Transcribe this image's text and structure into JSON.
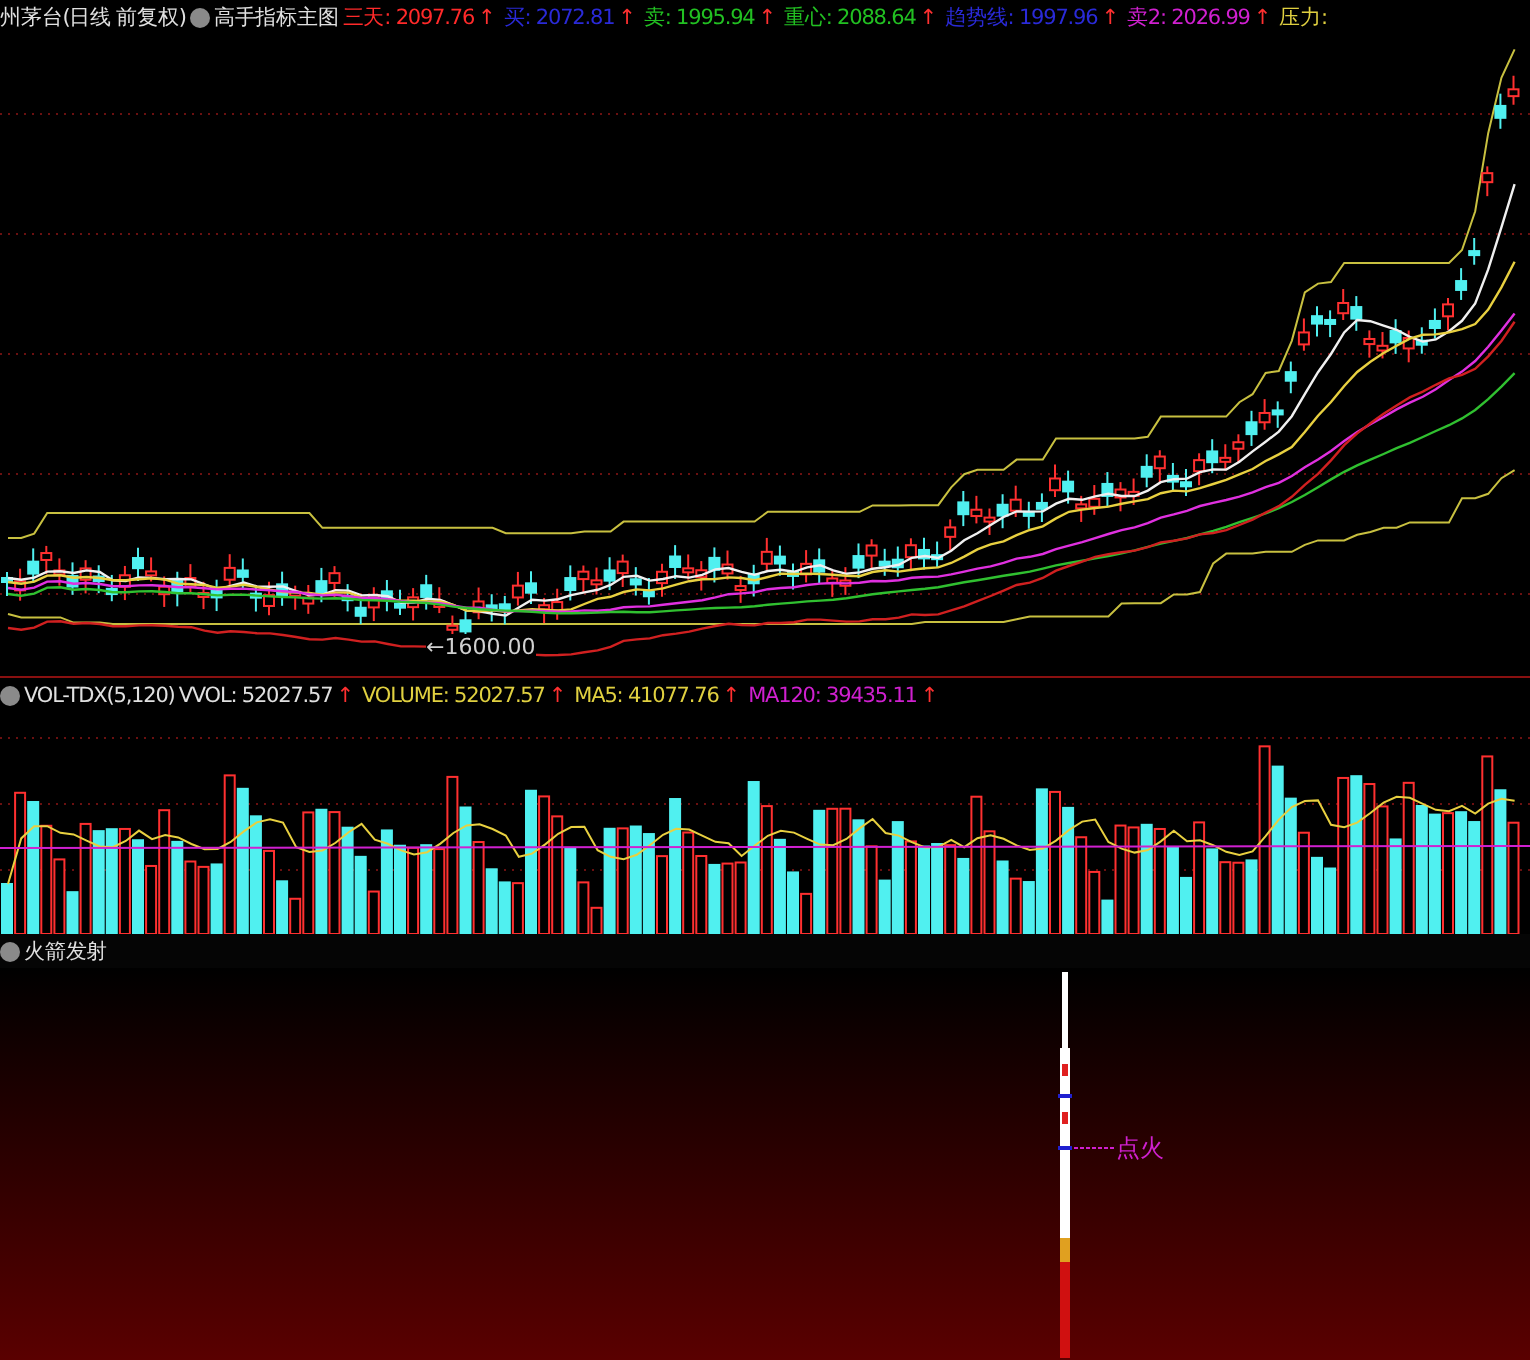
{
  "main_header": {
    "stock_title": "州茅台(日线 前复权)",
    "indicator_name": "高手指标主图",
    "values": [
      {
        "label": "三天:",
        "value": "2097.76",
        "arrow": "↑",
        "color": "#ff2a2a"
      },
      {
        "label": "买:",
        "value": "2072.81",
        "arrow": "↑",
        "color": "#2a2ad8"
      },
      {
        "label": "卖:",
        "value": "1995.94",
        "arrow": "↑",
        "color": "#22c022"
      },
      {
        "label": "重心:",
        "value": "2088.64",
        "arrow": "↑",
        "color": "#22c022"
      },
      {
        "label": "趋势线:",
        "value": "1997.96",
        "arrow": "↑",
        "color": "#2a2ad8"
      },
      {
        "label": "卖2:",
        "value": "2026.99",
        "arrow": "↑",
        "color": "#d020d0"
      },
      {
        "label": "压力:",
        "color": "#e0d040"
      }
    ]
  },
  "price_marker": "←1600.00",
  "volume_header": {
    "name": "VOL-TDX(5,120)",
    "values": [
      {
        "label": "VVOL:",
        "value": "52027.57",
        "arrow": "↑",
        "color": "#e0e0e0"
      },
      {
        "label": "VOLUME:",
        "value": "52027.57",
        "arrow": "↑",
        "color": "#e0d040"
      },
      {
        "label": "MA5:",
        "value": "41077.76",
        "arrow": "↑",
        "color": "#e0d040"
      },
      {
        "label": "MA120:",
        "value": "39435.11",
        "arrow": "↑",
        "color": "#d020d0"
      }
    ]
  },
  "rocket_panel": {
    "name": "火箭发射",
    "ignition_label": "点火"
  }
}
